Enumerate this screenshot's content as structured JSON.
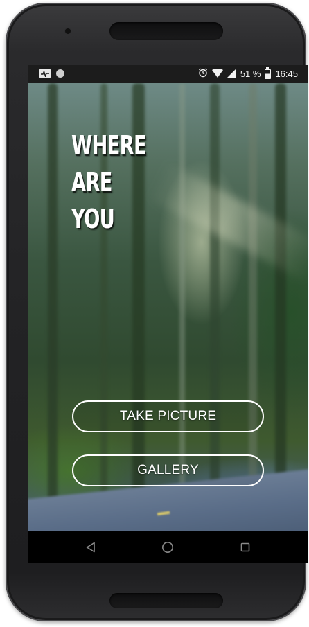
{
  "status_bar": {
    "left_icons": [
      "pulse-icon",
      "circle-icon"
    ],
    "right_icons": [
      "alarm-icon",
      "wifi-icon",
      "signal-icon",
      "battery-icon"
    ],
    "battery": "51 %",
    "time": "16:45"
  },
  "app": {
    "title_lines": [
      "WHERE",
      "ARE",
      "YOU"
    ],
    "take_picture_label": "TAKE PICTURE",
    "gallery_label": "GALLERY"
  },
  "nav_bar": {
    "icons": [
      "back-icon",
      "home-icon",
      "recents-icon"
    ]
  },
  "colors": {
    "button_border": "#ffffff",
    "status_bar_bg": "#1c1c1c",
    "nav_bar_bg": "#000000",
    "phone_body": "#232325"
  }
}
